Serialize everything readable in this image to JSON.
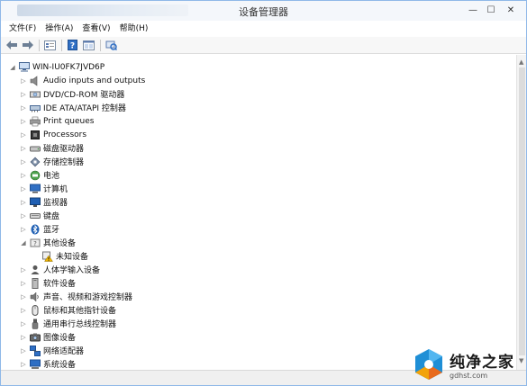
{
  "window": {
    "title": "设备管理器",
    "controls": {
      "minimize": "—",
      "maximize": "☐",
      "close": "✕"
    }
  },
  "menu": [
    "文件(F)",
    "操作(A)",
    "查看(V)",
    "帮助(H)"
  ],
  "toolbar": [
    "back-icon",
    "forward-icon",
    "properties-icon",
    "help-icon",
    "view-icon",
    "scan-hardware-icon"
  ],
  "tree": {
    "root": {
      "label": "WIN-IU0FK7JVD6P",
      "expanded": true
    },
    "items": [
      {
        "label": "Audio inputs and outputs",
        "icon": "speaker-icon",
        "expanded": false
      },
      {
        "label": "DVD/CD-ROM 驱动器",
        "icon": "dvd-drive-icon",
        "expanded": false
      },
      {
        "label": "IDE ATA/ATAPI 控制器",
        "icon": "ide-controller-icon",
        "expanded": false
      },
      {
        "label": "Print queues",
        "icon": "printer-icon",
        "expanded": false
      },
      {
        "label": "Processors",
        "icon": "processor-icon",
        "expanded": false
      },
      {
        "label": "磁盘驱动器",
        "icon": "disk-drive-icon",
        "expanded": false
      },
      {
        "label": "存储控制器",
        "icon": "storage-controller-icon",
        "expanded": false
      },
      {
        "label": "电池",
        "icon": "battery-icon",
        "expanded": false
      },
      {
        "label": "计算机",
        "icon": "computer-icon",
        "expanded": false
      },
      {
        "label": "监视器",
        "icon": "monitor-icon",
        "expanded": false
      },
      {
        "label": "键盘",
        "icon": "keyboard-icon",
        "expanded": false
      },
      {
        "label": "蓝牙",
        "icon": "bluetooth-icon",
        "expanded": false
      },
      {
        "label": "其他设备",
        "icon": "other-devices-icon",
        "expanded": true,
        "children": [
          {
            "label": "未知设备",
            "icon": "unknown-device-warning-icon"
          }
        ]
      },
      {
        "label": "人体学输入设备",
        "icon": "hid-icon",
        "expanded": false
      },
      {
        "label": "软件设备",
        "icon": "software-device-icon",
        "expanded": false
      },
      {
        "label": "声音、视频和游戏控制器",
        "icon": "sound-icon",
        "expanded": false
      },
      {
        "label": "鼠标和其他指针设备",
        "icon": "mouse-icon",
        "expanded": false
      },
      {
        "label": "通用串行总线控制器",
        "icon": "usb-icon",
        "expanded": false
      },
      {
        "label": "图像设备",
        "icon": "camera-icon",
        "expanded": false
      },
      {
        "label": "网络适配器",
        "icon": "network-adapter-icon",
        "expanded": false
      },
      {
        "label": "系统设备",
        "icon": "system-device-icon",
        "expanded": false
      }
    ]
  },
  "watermark": {
    "name": "纯净之家",
    "url": "gdhst.com"
  },
  "colors": {
    "window_border": "#8fb8e8",
    "toolbar_bg": "#f7f7f7",
    "status_bg": "#f0f0f0",
    "warning": "#f2b705"
  }
}
